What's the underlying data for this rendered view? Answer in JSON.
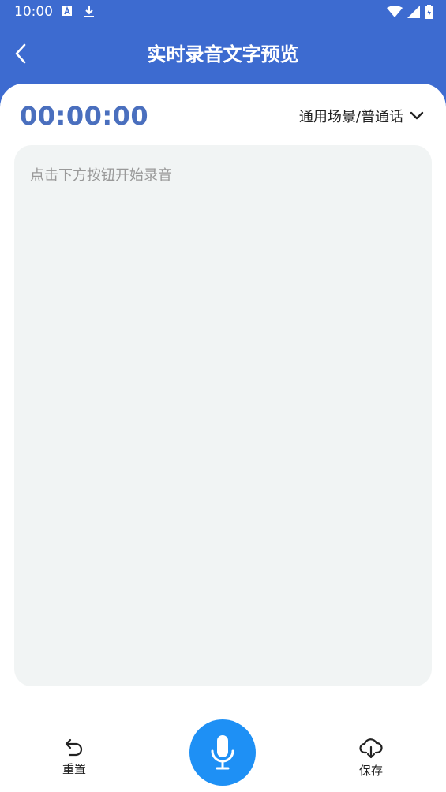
{
  "status_bar": {
    "time": "10:00",
    "left_icons": [
      "a-icon",
      "download-icon"
    ],
    "right_icons": [
      "wifi-icon",
      "signal-icon",
      "battery-icon"
    ]
  },
  "app_bar": {
    "title": "实时录音文字预览",
    "back_icon": "chevron-left-icon"
  },
  "recorder": {
    "timer": "00:00:00",
    "scene_label": "通用场景/普通话",
    "scene_icon": "chevron-down-icon",
    "placeholder": "点击下方按钮开始录音"
  },
  "bottom": {
    "reset_label": "重置",
    "save_label": "保存"
  },
  "colors": {
    "header": "#3D6BD0",
    "timer": "#4A6FBE",
    "mic": "#1E90F5",
    "text_area_bg": "#F1F4F4"
  }
}
